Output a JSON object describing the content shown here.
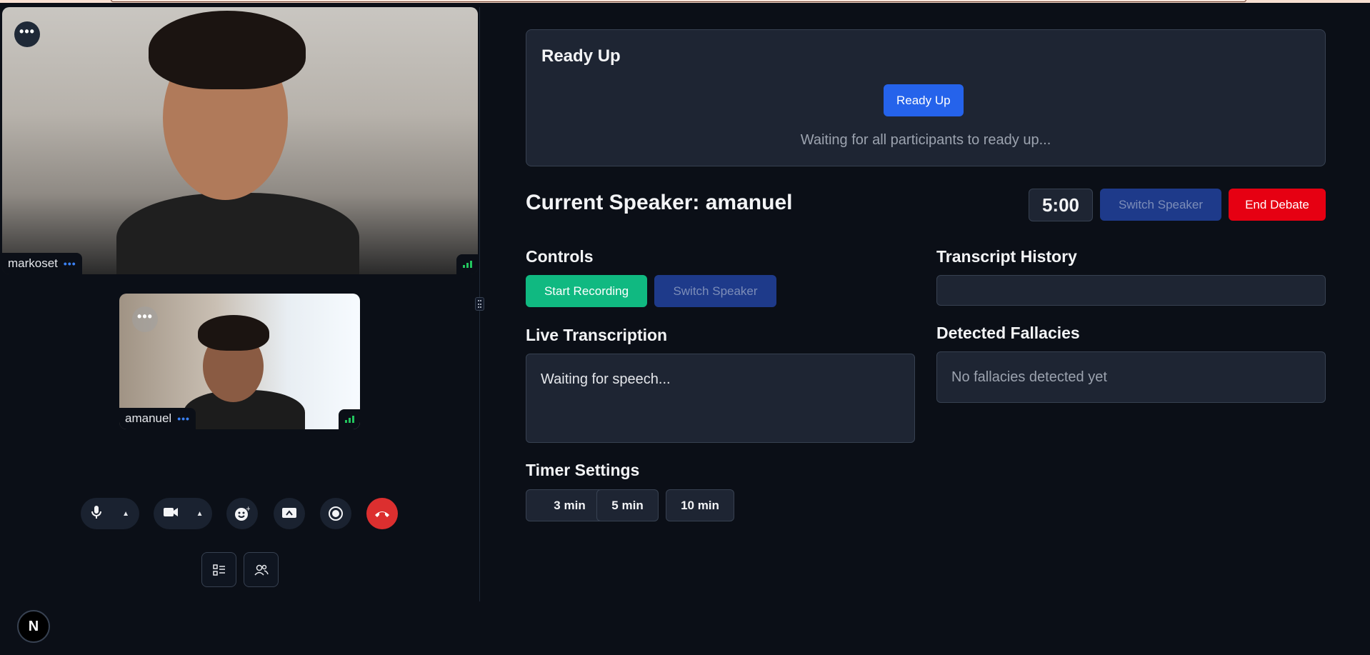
{
  "participants": [
    {
      "name": "markoset",
      "menu": "•••",
      "tag_menu": "•••"
    },
    {
      "name": "amanuel",
      "menu": "•••",
      "tag_menu": "•••"
    }
  ],
  "call_controls": {
    "items": [
      "microphone-icon",
      "camera-icon",
      "emoji-reaction-icon",
      "screen-share-icon",
      "record-icon",
      "hang-up-icon"
    ],
    "secondary": [
      "layout-list-icon",
      "people-icon"
    ],
    "badge": "N",
    "colors": {
      "end_call": "#dc2f2f"
    }
  },
  "ready": {
    "title": "Ready Up",
    "button": "Ready Up",
    "status": "Waiting for all participants to ready up..."
  },
  "speaker": {
    "title": "Current Speaker: amanuel",
    "timer": "5:00",
    "switch_button": "Switch Speaker",
    "end_button": "End Debate"
  },
  "controls": {
    "heading": "Controls",
    "start_recording": "Start Recording",
    "switch_speaker": "Switch Speaker"
  },
  "live_transcription": {
    "heading": "Live Transcription",
    "text": "Waiting for speech..."
  },
  "transcript_history": {
    "heading": "Transcript History",
    "text": ""
  },
  "fallacies": {
    "heading": "Detected Fallacies",
    "text": "No fallacies detected yet"
  },
  "timer_settings": {
    "heading": "Timer Settings",
    "options": [
      "3 min",
      "5 min",
      "10 min"
    ]
  },
  "colors": {
    "background": "#0b0f17",
    "panel": "#1e2533",
    "primary": "#2563eb",
    "danger": "#e60012",
    "success": "#10b981"
  }
}
